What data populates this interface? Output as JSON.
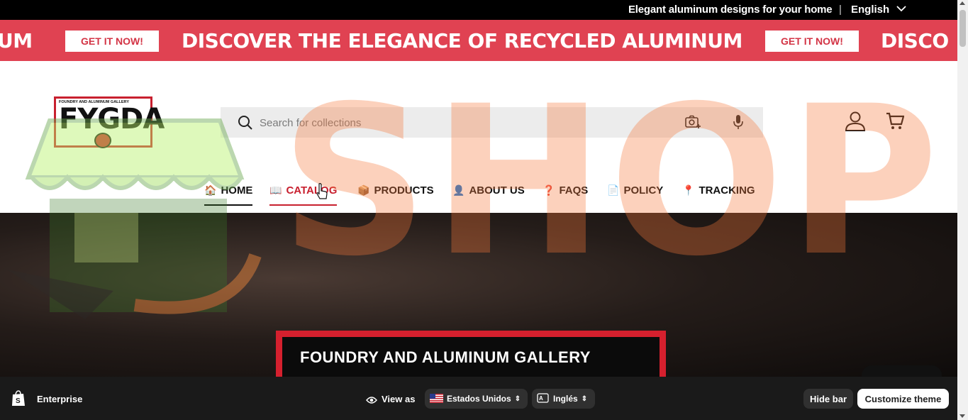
{
  "topbar": {
    "message": "Elegant aluminum designs for your home",
    "separator": "|",
    "language": "English"
  },
  "marquee": {
    "items": [
      {
        "text": "UM"
      },
      {
        "button": "GET IT NOW!"
      },
      {
        "text": "DISCOVER THE ELEGANCE OF RECYCLED ALUMINUM"
      },
      {
        "button": "GET IT NOW!"
      },
      {
        "text": "DISCO"
      }
    ],
    "background": "#e04252"
  },
  "header": {
    "logo": {
      "subtitle": "FOUNDRY AND ALUMINUM GALLERY",
      "name": "FYGDA"
    },
    "search": {
      "placeholder": "Search for collections"
    },
    "nav": [
      {
        "label": "HOME",
        "emoji": "🏠"
      },
      {
        "label": "CATALOG",
        "emoji": "📖"
      },
      {
        "label": "PRODUCTS",
        "emoji": "📦"
      },
      {
        "label": "ABOUT US",
        "emoji": "👤"
      },
      {
        "label": "FAQS",
        "emoji": "❓"
      },
      {
        "label": "POLICY",
        "emoji": "📄"
      },
      {
        "label": "TRACKING",
        "emoji": "📍"
      }
    ]
  },
  "hero": {
    "banner_text": "FOUNDRY AND ALUMINUM GALLERY"
  },
  "watermark": {
    "text": "SHOPIX"
  },
  "adminbar": {
    "plan": "Enterprise",
    "view_as": "View as",
    "country": "Estados Unidos",
    "language": "Inglés",
    "hide_bar": "Hide bar",
    "customize": "Customize theme"
  },
  "colors": {
    "accent": "#c8202f",
    "brand_red": "#e04252",
    "admin_bg": "#1a1a1a"
  }
}
